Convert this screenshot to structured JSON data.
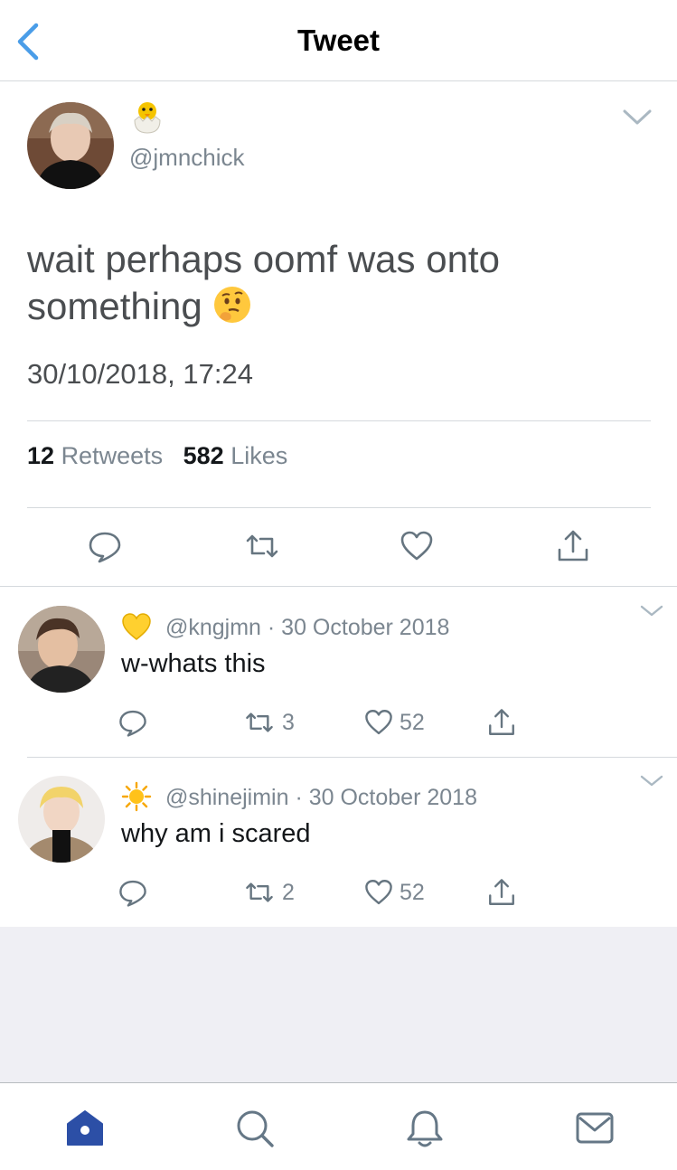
{
  "header": {
    "title": "Tweet"
  },
  "main_tweet": {
    "handle": "@jmnchick",
    "text": "wait perhaps oomf was onto something",
    "timestamp": "30/10/2018, 17:24",
    "retweets_count": "12",
    "retweets_label": "Retweets",
    "likes_count": "582",
    "likes_label": "Likes"
  },
  "replies": [
    {
      "handle": "@kngjmn",
      "date": "30 October 2018",
      "text": "w-whats this",
      "retweets": "3",
      "likes": "52",
      "emoji": "yellow-heart-icon"
    },
    {
      "handle": "@shinejimin",
      "date": "30 October 2018",
      "text": "why am i scared",
      "retweets": "2",
      "likes": "52",
      "emoji": "sun-icon"
    }
  ],
  "colors": {
    "accent_blue": "#1da1f2",
    "nav_blue": "#2c4fa6",
    "gray_text": "#7b8690",
    "tweet_text": "#4a4d50"
  },
  "tabbar": [
    "home-icon",
    "search-icon",
    "notifications-icon",
    "messages-icon"
  ]
}
